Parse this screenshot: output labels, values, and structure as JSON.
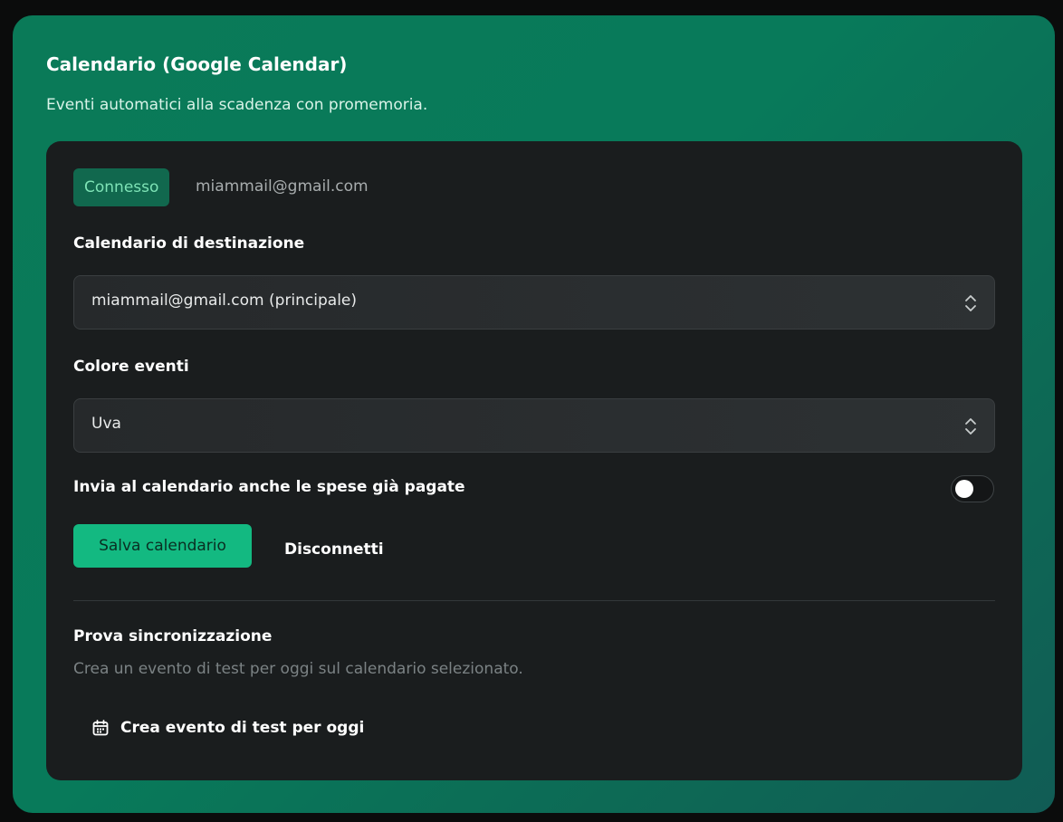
{
  "card": {
    "title": "Calendario (Google Calendar)",
    "subtitle": "Eventi automatici alla scadenza con promemoria."
  },
  "status": {
    "badge": "Connesso",
    "email": "miammail@gmail.com"
  },
  "calendar_select": {
    "label": "Calendario di destinazione",
    "value": "miammail@gmail.com (principale)"
  },
  "color_select": {
    "label": "Colore eventi",
    "value": "Uva"
  },
  "paid_toggle": {
    "label": "Invia al calendario anche le spese già pagate",
    "enabled": false
  },
  "actions": {
    "save_label": "Salva calendario",
    "disconnect_label": "Disconnetti"
  },
  "sync_test": {
    "title": "Prova sincronizzazione",
    "description": "Crea un evento di test per oggi sul calendario selezionato.",
    "button_label": "Crea evento di test per oggi",
    "button_icon": "calendar-icon"
  },
  "colors": {
    "accent": "#13b981",
    "badge_bg": "#11684e",
    "badge_text": "#7ee3b6",
    "panel_bg": "#1a1d1e"
  }
}
